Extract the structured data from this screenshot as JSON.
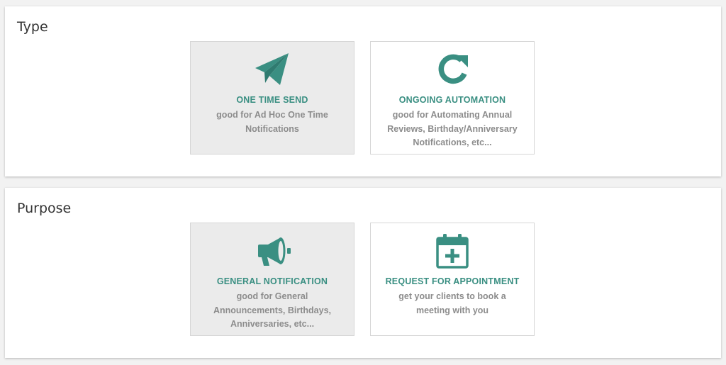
{
  "colors": {
    "accent": "#3a8f82",
    "selected_bg": "#ebebeb",
    "desc_text": "#8c8c8c"
  },
  "type_section": {
    "title": "Type",
    "cards": [
      {
        "title": "ONE TIME SEND",
        "description": "good for Ad Hoc One Time Notifications",
        "icon": "paper-plane-icon",
        "selected": true
      },
      {
        "title": "ONGOING AUTOMATION",
        "description": "good for Automating Annual Reviews, Birthday/Anniversary Notifications, etc...",
        "icon": "refresh-icon",
        "selected": false
      }
    ]
  },
  "purpose_section": {
    "title": "Purpose",
    "cards": [
      {
        "title": "GENERAL NOTIFICATION",
        "description": "good for General Announcements, Birthdays, Anniversaries, etc...",
        "icon": "megaphone-icon",
        "selected": true
      },
      {
        "title": "REQUEST FOR APPOINTMENT",
        "description": "get your clients to book a meeting with you",
        "icon": "calendar-plus-icon",
        "selected": false
      }
    ]
  }
}
